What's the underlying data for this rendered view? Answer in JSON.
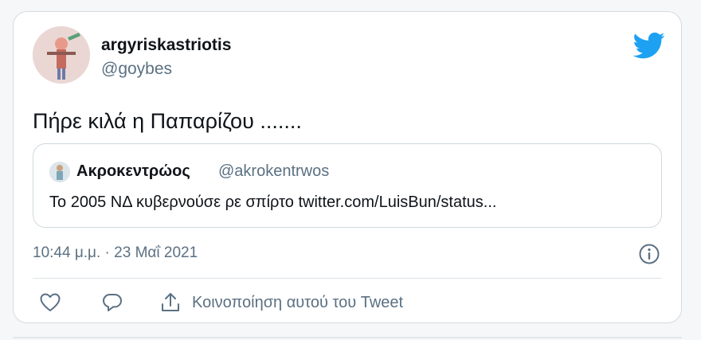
{
  "tweet": {
    "author_name": "argyriskastriotis",
    "author_handle": "@goybes",
    "text": "Πήρε κιλά η Παπαρίζου .......",
    "timestamp": "10:44 μ.μ. · 23 Μαΐ 2021"
  },
  "quoted_tweet": {
    "author_name": "Ακροκεντρώος",
    "author_handle": "@akrokentrwos",
    "text": "Το 2005 ΝΔ κυβερνούσε ρε σπίρτο twitter.com/LuisBun/status..."
  },
  "actions": {
    "share_label": "Κοινοποίηση αυτού του Tweet"
  },
  "icons": {
    "brand": "twitter-bird-icon",
    "info": "info-icon",
    "like": "heart-icon",
    "reply": "reply-icon",
    "share": "share-icon"
  },
  "colors": {
    "brand": "#1da1f2",
    "secondary_text": "#5b7083",
    "primary_text": "#0f1419",
    "border": "#cfd9de"
  }
}
